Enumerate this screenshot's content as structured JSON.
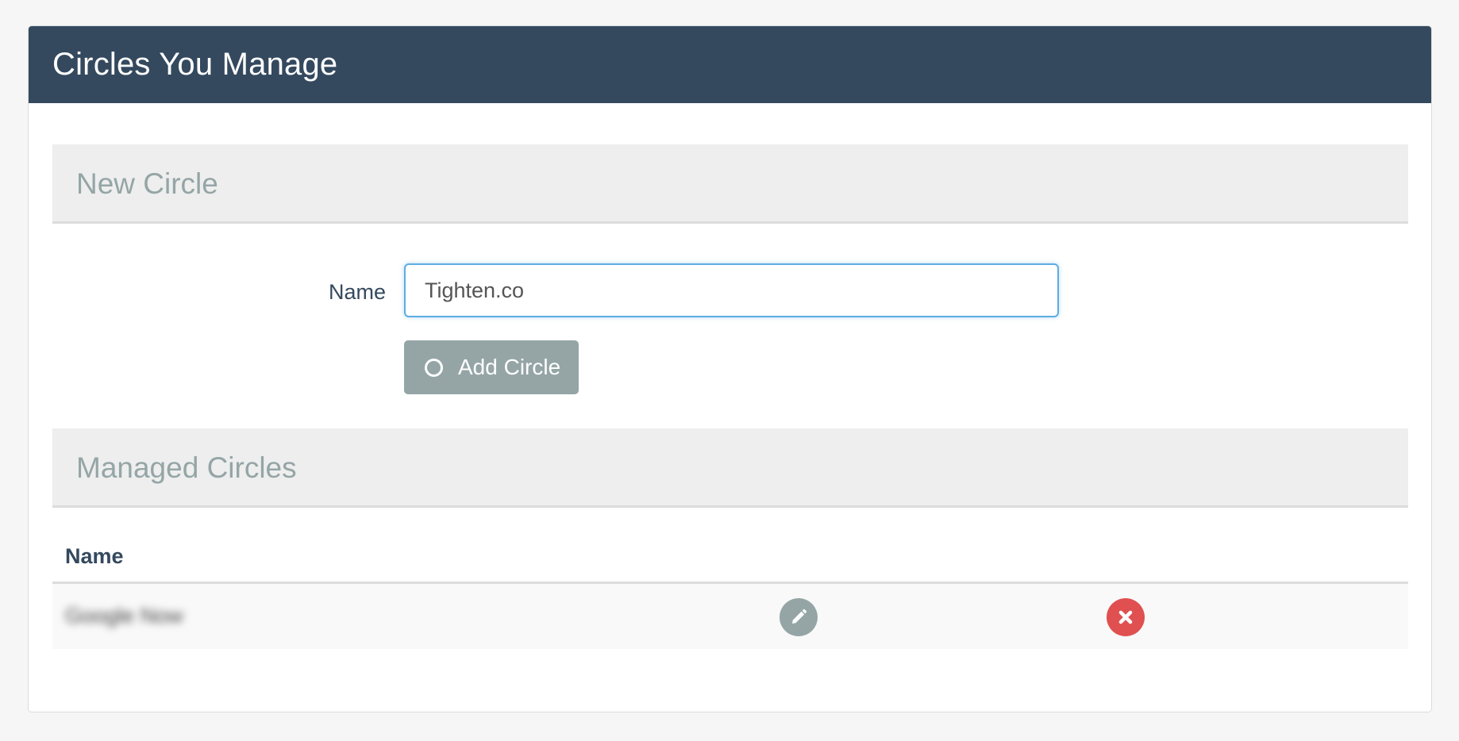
{
  "panel": {
    "title": "Circles You Manage"
  },
  "new_circle": {
    "heading": "New Circle",
    "name_label": "Name",
    "name_value": "Tighten.co",
    "add_button_label": "Add Circle",
    "add_button_icon": "circle-outline-icon"
  },
  "managed_circles": {
    "heading": "Managed Circles",
    "columns": [
      "Name"
    ],
    "rows": [
      {
        "name": "Google Now",
        "edit_icon": "pencil-icon",
        "delete_icon": "x-icon"
      }
    ]
  },
  "colors": {
    "header_bg": "#34495e",
    "button_gray": "#95a5a6",
    "delete_red": "#e05050",
    "focus_blue": "#5dade2"
  }
}
